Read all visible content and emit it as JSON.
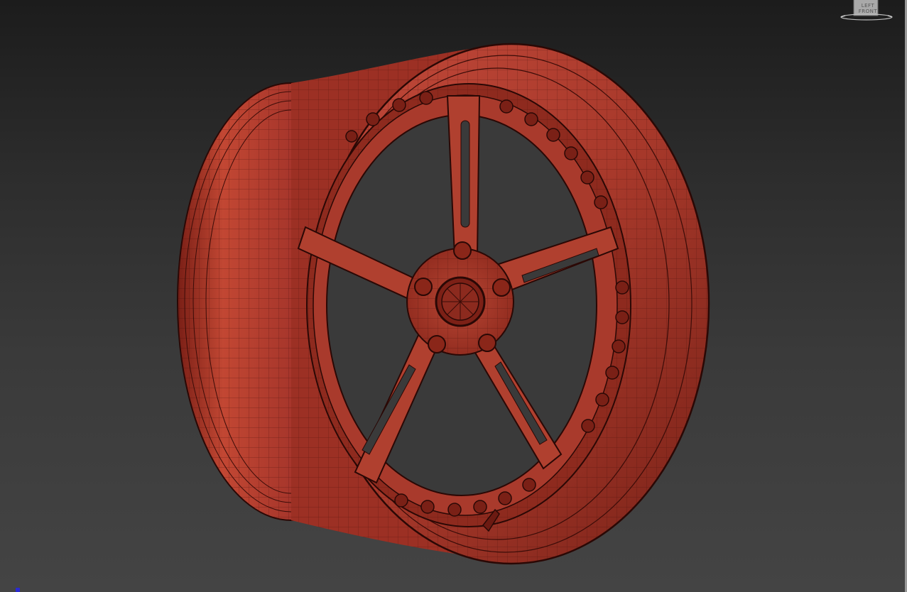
{
  "viewport": {
    "viewcube": {
      "label": "LEFT FRONT"
    },
    "colors": {
      "background_top": "#1c1c1c",
      "background_bottom": "#444444",
      "wheel_body": "#b63a2c",
      "wheel_shadow": "#6e1a12",
      "wire": "#3a0c08"
    },
    "model": {
      "icon": "wheel-rim-wireframe-icon"
    }
  }
}
